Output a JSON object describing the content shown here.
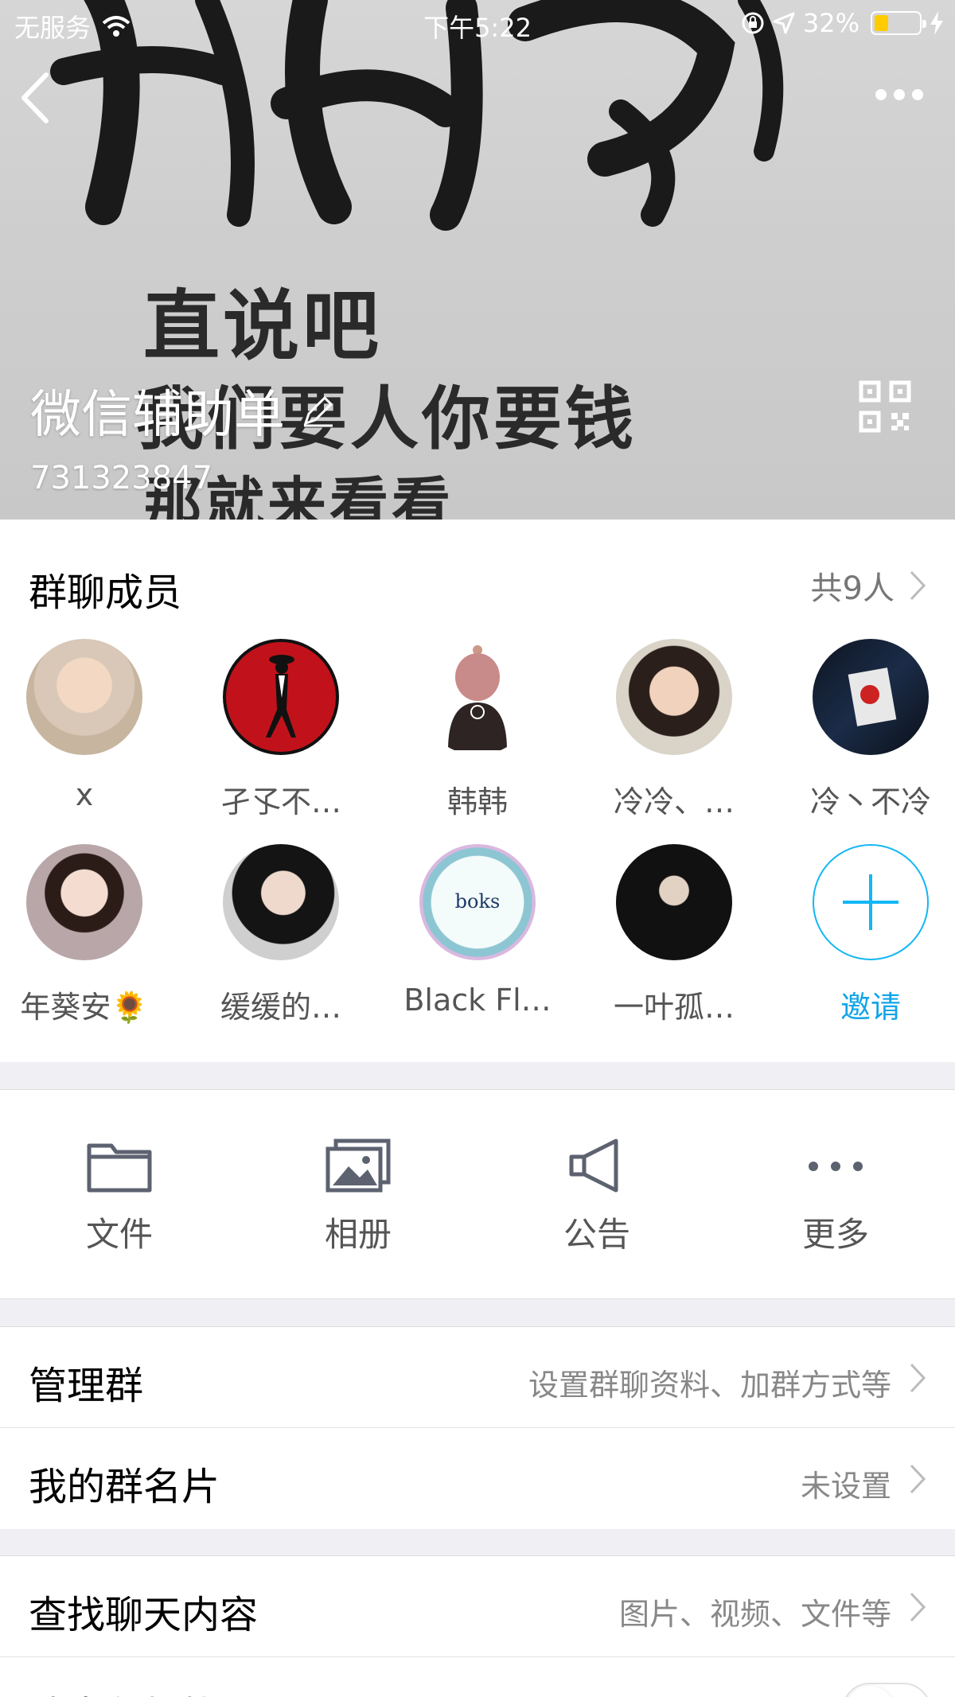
{
  "status_bar": {
    "carrier": "无服务",
    "time": "下午5:22",
    "battery_percent": "32%",
    "battery_level": 0.32
  },
  "header": {
    "group_name": "微信辅助单",
    "group_id": "731323847",
    "banner_lines": [
      "直说吧",
      "我们要人你要钱",
      "那就来看看"
    ]
  },
  "members": {
    "title": "群聊成员",
    "count": "共9人",
    "list": [
      {
        "name": "x"
      },
      {
        "name": "孑孓不…"
      },
      {
        "name": "韩韩"
      },
      {
        "name": "冷冷、…"
      },
      {
        "name": "冷丶不冷"
      },
      {
        "name": "年葵安🌻"
      },
      {
        "name": "缓缓的…"
      },
      {
        "name": "Black Fl…"
      },
      {
        "name": "一叶孤…"
      }
    ],
    "invite_label": "邀请"
  },
  "actions": [
    {
      "label": "文件",
      "icon": "folder-icon"
    },
    {
      "label": "相册",
      "icon": "photo-album-icon"
    },
    {
      "label": "公告",
      "icon": "megaphone-icon"
    },
    {
      "label": "更多",
      "icon": "more-dots-icon"
    }
  ],
  "settings": {
    "manage": {
      "title": "管理群",
      "value": "设置群聊资料、加群方式等"
    },
    "card": {
      "title": "我的群名片",
      "value": "未设置"
    },
    "search": {
      "title": "查找聊天内容",
      "value": "图片、视频、文件等"
    },
    "dnd": {
      "title": "消息免打扰"
    }
  },
  "colors": {
    "accent": "#12b7f5",
    "background": "#efeff4"
  }
}
